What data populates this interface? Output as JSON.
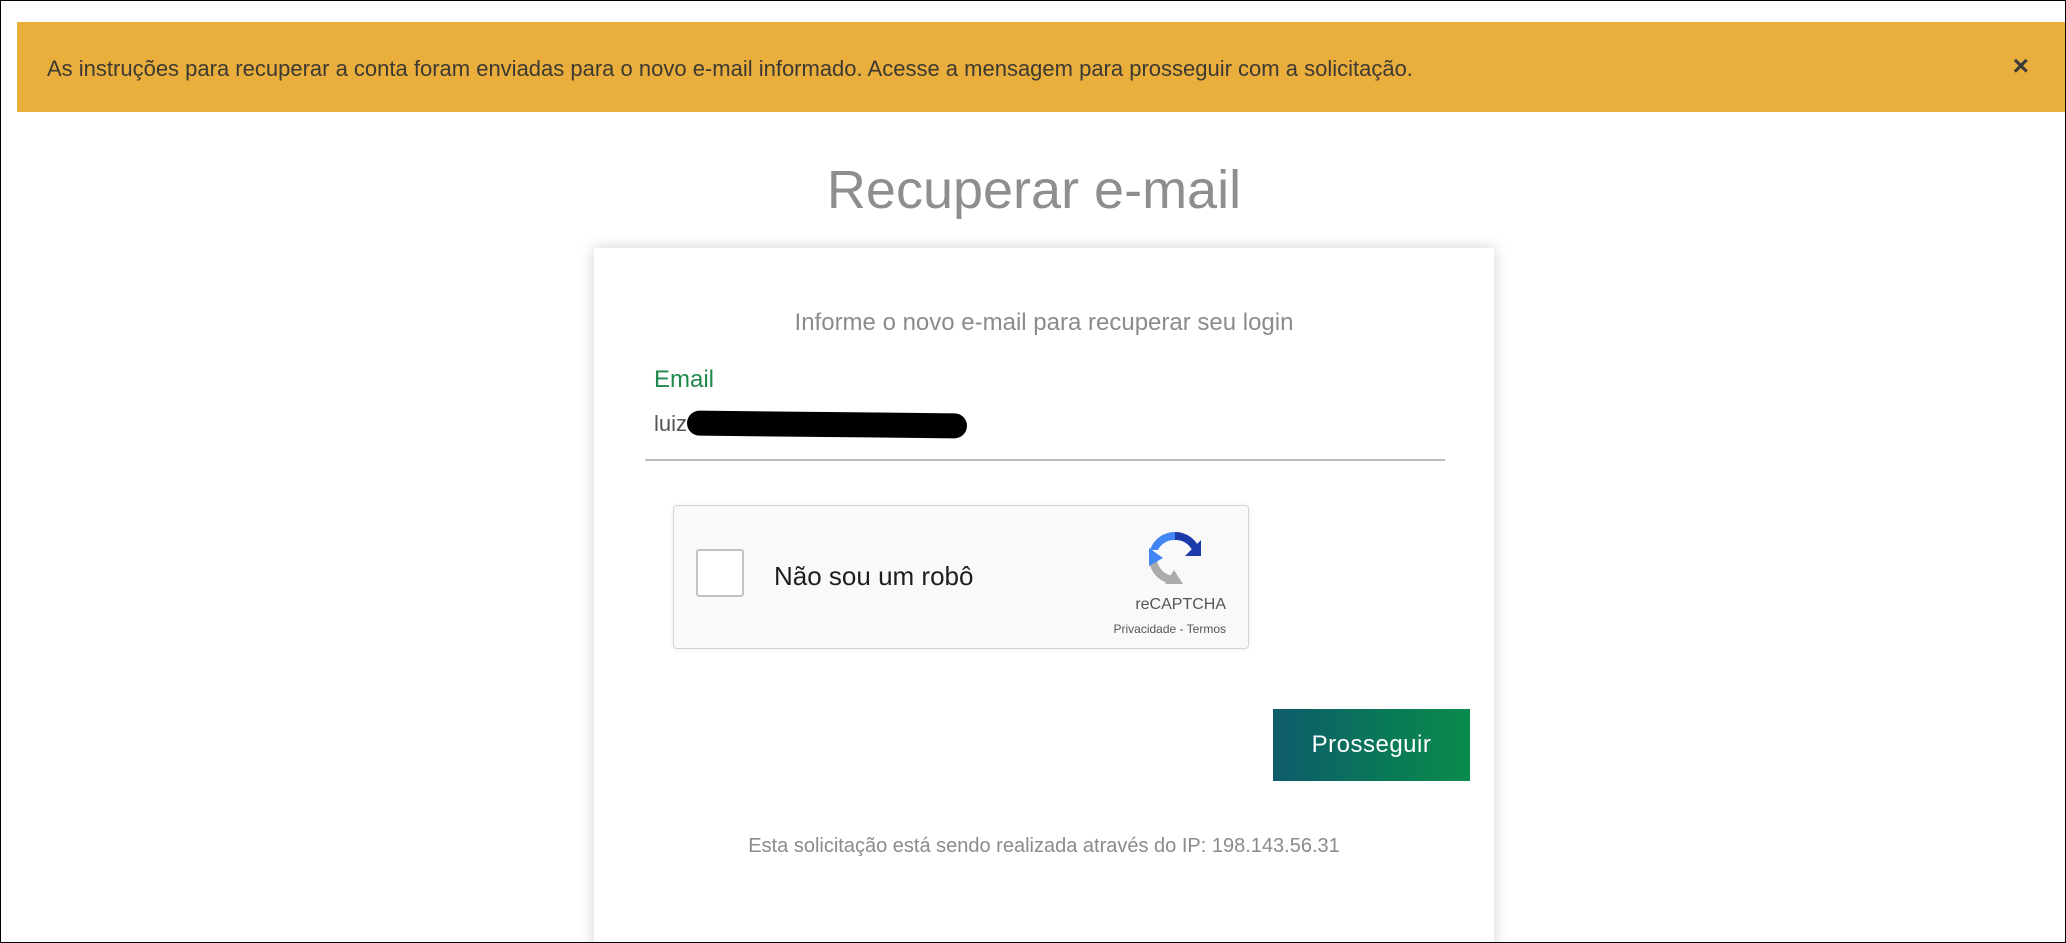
{
  "alert": {
    "message": "As instruções para recuperar a conta foram enviadas para o novo e-mail informado. Acesse a mensagem para prosseguir com a solicitação.",
    "close_symbol": "×",
    "background_color": "#e9ae3b"
  },
  "page": {
    "title": "Recuperar e-mail"
  },
  "form": {
    "subtitle": "Informe o novo e-mail para recuperar seu login",
    "email_label": "Email",
    "email_value": "luiz",
    "email_label_color": "#1f8a4c"
  },
  "captcha": {
    "checkbox_label": "Não sou um robô",
    "brand": "reCAPTCHA",
    "privacy_link": "Privacidade",
    "separator": " - ",
    "terms_link": "Termos",
    "icon": "recaptcha-icon"
  },
  "actions": {
    "submit_label": "Prosseguir",
    "submit_color": "#097a56"
  },
  "footer": {
    "ip_text": "Esta solicitação está sendo realizada através do IP: 198.143.56.31"
  }
}
